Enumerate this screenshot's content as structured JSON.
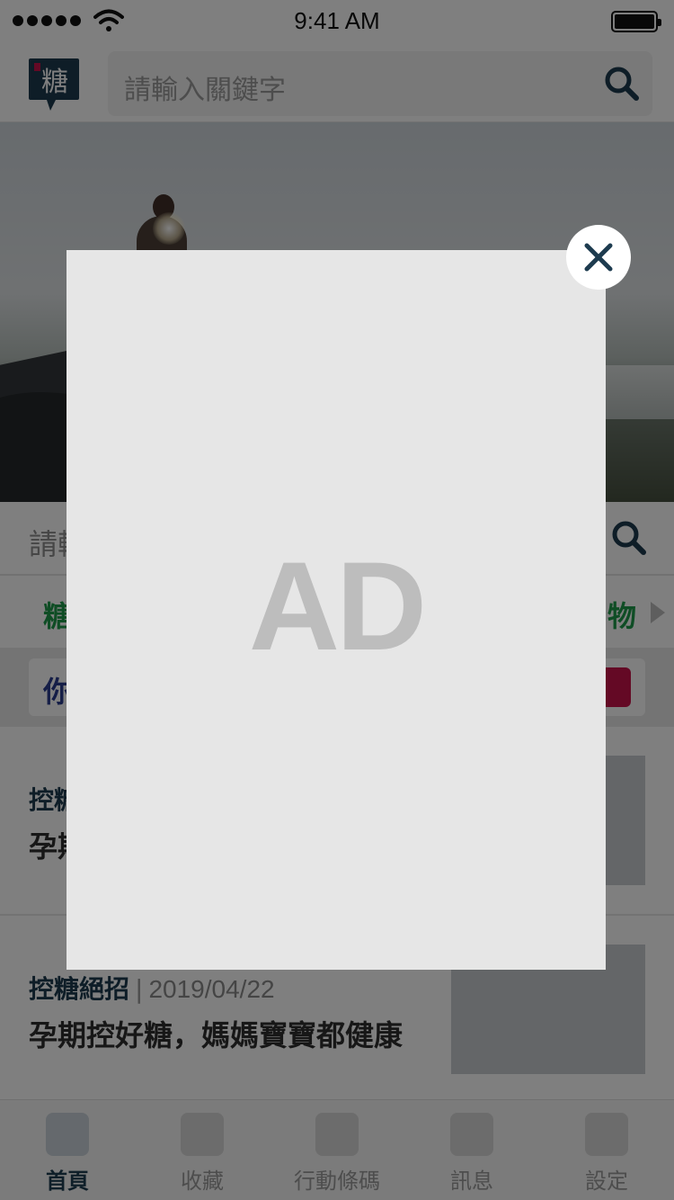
{
  "status_bar": {
    "time": "9:41 AM"
  },
  "header": {
    "logo_char": "糖",
    "search_placeholder": "請輸入關鍵字"
  },
  "search2": {
    "placeholder_visible": "請輸"
  },
  "category_bar": {
    "left_label_visible": "糖",
    "right_label_visible": "物"
  },
  "banner": {
    "text_visible": "你"
  },
  "articles": [
    {
      "category": "控糖",
      "date": "",
      "title": "孕期"
    },
    {
      "category": "控糖絕招",
      "date": "2019/04/22",
      "title": "孕期控好糖，媽媽寶寶都健康"
    }
  ],
  "tabs": [
    {
      "label": "首頁",
      "active": true
    },
    {
      "label": "收藏"
    },
    {
      "label": "行動條碼"
    },
    {
      "label": "訊息"
    },
    {
      "label": "設定"
    }
  ],
  "ad": {
    "label": "AD"
  },
  "colors": {
    "brand_dark": "#1d3b4f",
    "category_green": "#1f9b4a",
    "accent_red": "#c8124a",
    "banner_blue": "#2b3c8f"
  }
}
